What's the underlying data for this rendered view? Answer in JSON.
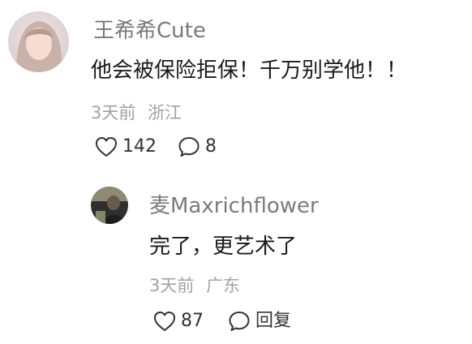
{
  "comment": {
    "author": "王希希Cute",
    "text": "他会被保险拒保！千万别学他！！",
    "time": "3天前",
    "location": "浙江",
    "likes": "142",
    "replies": "8",
    "avatar": "avatar-icon"
  },
  "reply": {
    "author": "麦Maxrichflower",
    "text": "完了，更艺术了",
    "time": "3天前",
    "location": "广东",
    "likes": "87",
    "reply_label": "回复",
    "avatar": "avatar-icon"
  },
  "icons": {
    "like": "heart-outline-icon",
    "reply": "speech-bubble-outline-icon"
  },
  "colors": {
    "author": "#7a7a7a",
    "text": "#1a1a1a",
    "meta": "#a2a2a2",
    "action": "#333333"
  }
}
